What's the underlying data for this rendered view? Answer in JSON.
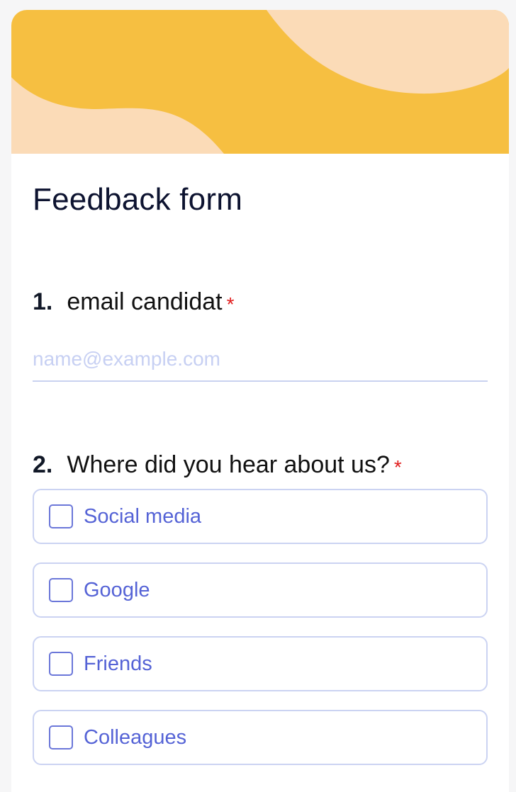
{
  "form": {
    "title": "Feedback form"
  },
  "questions": [
    {
      "number": "1.",
      "text": "email candidat",
      "required_marker": "*",
      "input": {
        "placeholder": "name@example.com",
        "value": ""
      }
    },
    {
      "number": "2.",
      "text": "Where did you hear about us?",
      "required_marker": "*",
      "options": [
        {
          "label": "Social media",
          "checked": false
        },
        {
          "label": "Google",
          "checked": false
        },
        {
          "label": "Friends",
          "checked": false
        },
        {
          "label": "Colleagues",
          "checked": false
        }
      ]
    }
  ],
  "colors": {
    "banner_background": "#f6bf41",
    "banner_shapes": "#fbdbb7",
    "title_text": "#0d1330",
    "required_asterisk": "#e11d1d",
    "option_text": "#5563d6",
    "option_border": "#cbd3f2",
    "checkbox_border": "#6b77d9",
    "placeholder_text": "#c7d0f3"
  }
}
